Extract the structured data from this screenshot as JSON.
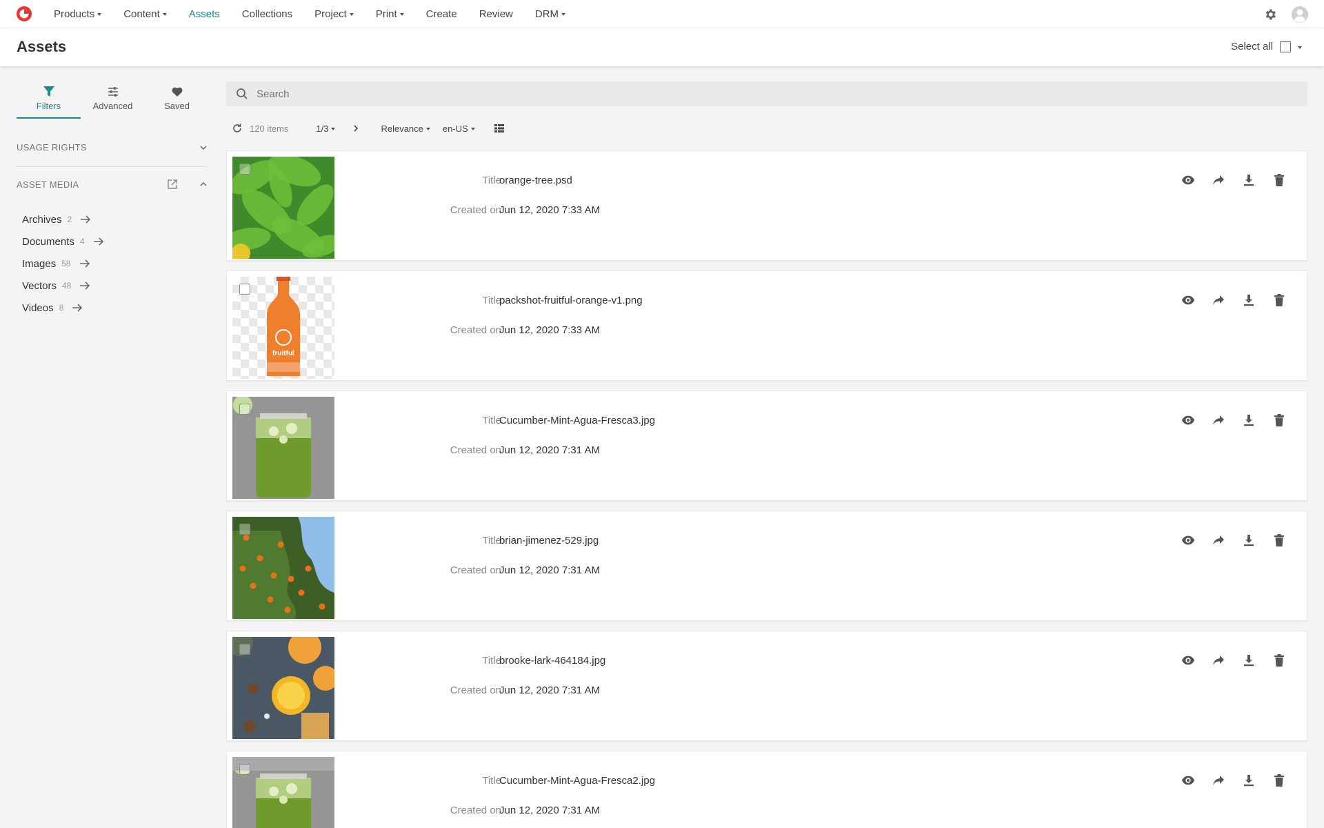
{
  "nav": {
    "items": [
      {
        "label": "Products",
        "dropdown": true,
        "active": false
      },
      {
        "label": "Content",
        "dropdown": true,
        "active": false
      },
      {
        "label": "Assets",
        "dropdown": false,
        "active": true
      },
      {
        "label": "Collections",
        "dropdown": false,
        "active": false
      },
      {
        "label": "Project",
        "dropdown": true,
        "active": false
      },
      {
        "label": "Print",
        "dropdown": true,
        "active": false
      },
      {
        "label": "Create",
        "dropdown": false,
        "active": false
      },
      {
        "label": "Review",
        "dropdown": false,
        "active": false
      },
      {
        "label": "DRM",
        "dropdown": true,
        "active": false
      }
    ],
    "accent_color": "#1d8a8f",
    "logo_color": "#e8372d"
  },
  "header": {
    "title": "Assets",
    "select_all_label": "Select all"
  },
  "sidebar": {
    "tabs": [
      {
        "label": "Filters",
        "icon": "filter-icon",
        "active": true
      },
      {
        "label": "Advanced",
        "icon": "sliders-icon",
        "active": false
      },
      {
        "label": "Saved",
        "icon": "heart-icon",
        "active": false
      }
    ],
    "usage_rights_label": "USAGE RIGHTS",
    "asset_media_label": "ASSET MEDIA",
    "media_items": [
      {
        "label": "Archives",
        "count": "2"
      },
      {
        "label": "Documents",
        "count": "4"
      },
      {
        "label": "Images",
        "count": "58"
      },
      {
        "label": "Vectors",
        "count": "48"
      },
      {
        "label": "Videos",
        "count": "8"
      }
    ]
  },
  "search": {
    "placeholder": "Search"
  },
  "toolbar": {
    "items_count": "120 items",
    "page": "1/3",
    "sort": "Relevance",
    "locale": "en-US"
  },
  "assets": {
    "title_label": "Title",
    "created_label": "Created on",
    "list": [
      {
        "title": "orange-tree.psd",
        "created": "Jun 12, 2020 7:33 AM",
        "thumb": "leaves"
      },
      {
        "title": "packshot-fruitful-orange-v1.png",
        "created": "Jun 12, 2020 7:33 AM",
        "thumb": "bottle"
      },
      {
        "title": "Cucumber-Mint-Agua-Fresca3.jpg",
        "created": "Jun 12, 2020 7:31 AM",
        "thumb": "jar"
      },
      {
        "title": "brian-jimenez-529.jpg",
        "created": "Jun 12, 2020 7:31 AM",
        "thumb": "tree"
      },
      {
        "title": "brooke-lark-464184.jpg",
        "created": "Jun 12, 2020 7:31 AM",
        "thumb": "juice"
      },
      {
        "title": "Cucumber-Mint-Agua-Fresca2.jpg",
        "created": "Jun 12, 2020 7:31 AM",
        "thumb": "jar2"
      }
    ]
  },
  "bottle_label": "fruitful"
}
